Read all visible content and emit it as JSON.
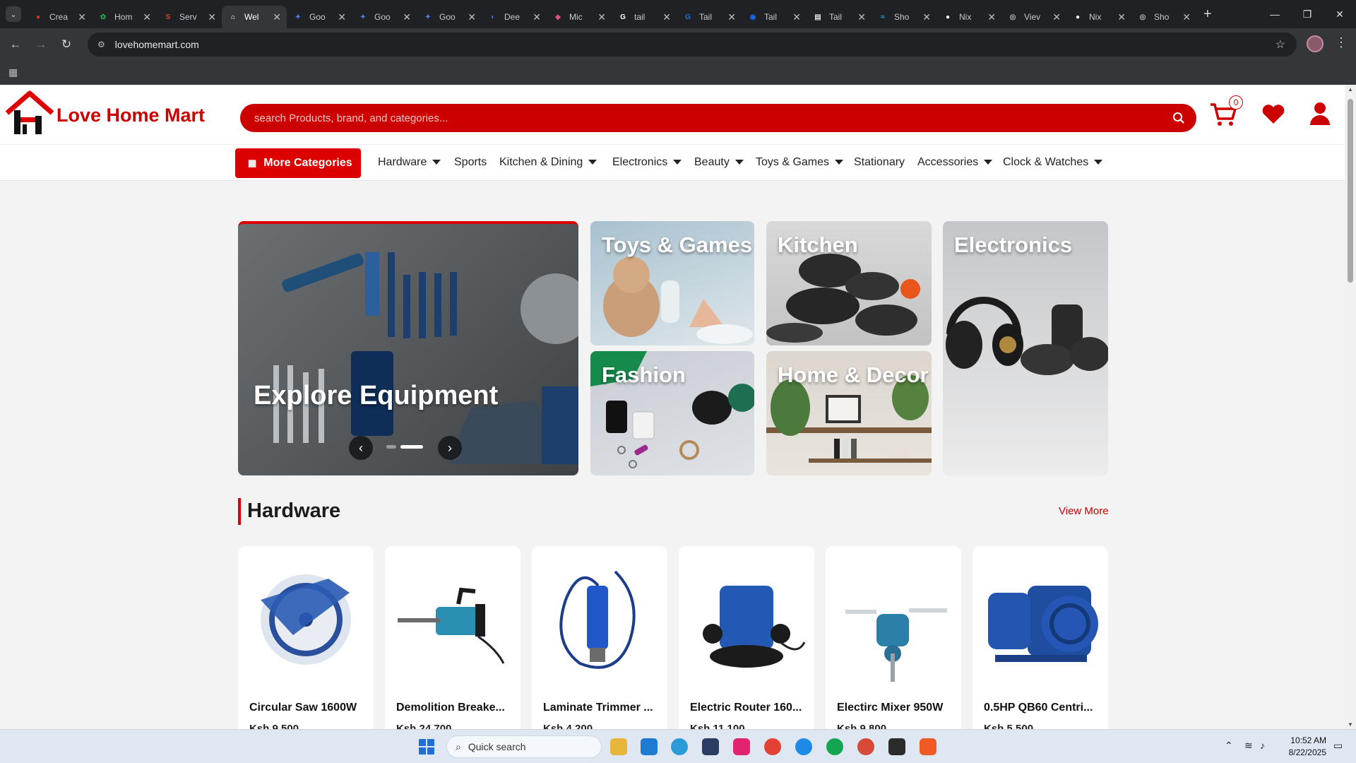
{
  "browser": {
    "tabs": [
      {
        "title": "Crea",
        "fav_color": "#d93025",
        "glyph": "●"
      },
      {
        "title": "Hom",
        "fav_color": "#23a84b",
        "glyph": "✿"
      },
      {
        "title": "Serv",
        "fav_color": "#d2481e",
        "glyph": "S"
      },
      {
        "title": "Wel",
        "fav_color": "#ffffff",
        "glyph": "⌂",
        "active": true
      },
      {
        "title": "Goo",
        "fav_color": "#4a7de8",
        "glyph": "✦"
      },
      {
        "title": "Goo",
        "fav_color": "#4a7de8",
        "glyph": "✦"
      },
      {
        "title": "Goo",
        "fav_color": "#4a7de8",
        "glyph": "✦"
      },
      {
        "title": "Dee",
        "fav_color": "#4d6bfe",
        "glyph": "◐"
      },
      {
        "title": "Mic",
        "fav_color": "#e24d8a",
        "glyph": "◆"
      },
      {
        "title": "tail",
        "fav_color": "#ffffff",
        "glyph": "G"
      },
      {
        "title": "Tail",
        "fav_color": "#1a73e8",
        "glyph": "G"
      },
      {
        "title": "Tail",
        "fav_color": "#1b66e6",
        "glyph": "◉"
      },
      {
        "title": "Tail",
        "fav_color": "#dcdcdc",
        "glyph": "▤"
      },
      {
        "title": "Sho",
        "fav_color": "#1aa7ec",
        "glyph": "≈"
      },
      {
        "title": "Nix",
        "fav_color": "#ffffff",
        "glyph": "●"
      },
      {
        "title": "Viev",
        "fav_color": "#bdbdbd",
        "glyph": "◎"
      },
      {
        "title": "Nix",
        "fav_color": "#ffffff",
        "glyph": "●"
      },
      {
        "title": "Sho",
        "fav_color": "#bdbdbd",
        "glyph": "◎"
      }
    ],
    "url": "lovehomemart.com"
  },
  "site": {
    "logo_text": "Love Home Mart",
    "search_placeholder": "search Products, brand, and categories...",
    "cart_count": "0",
    "brand_color": "#cc0000",
    "more_categories": "More Categories",
    "categories": [
      {
        "label": "Hardware",
        "dropdown": true
      },
      {
        "label": "Sports",
        "dropdown": false
      },
      {
        "label": "Kitchen & Dining",
        "dropdown": true
      },
      {
        "label": "Electronics",
        "dropdown": true
      },
      {
        "label": "Beauty",
        "dropdown": true
      },
      {
        "label": "Toys & Games",
        "dropdown": true
      },
      {
        "label": "Stationary",
        "dropdown": false
      },
      {
        "label": "Accessories",
        "dropdown": true
      },
      {
        "label": "Clock & Watches",
        "dropdown": true
      }
    ]
  },
  "hero": {
    "slide_title": "Explore Equipment",
    "prev_glyph": "‹",
    "next_glyph": "›",
    "tiles": {
      "toys": "Toys & Games",
      "kitchen": "Kitchen",
      "electronics": "Electronics",
      "fashion": "Fashion",
      "home": "Home & Decor"
    }
  },
  "section": {
    "title": "Hardware",
    "view_more": "View More",
    "products": [
      {
        "name": "Circular Saw 1600W",
        "price": "Ksh 9,500"
      },
      {
        "name": "Demolition Breake...",
        "price": "Ksh 24,700"
      },
      {
        "name": "Laminate Trimmer ...",
        "price": "Ksh 4,200"
      },
      {
        "name": "Electric Router 160...",
        "price": "Ksh 11,100"
      },
      {
        "name": "Electirc Mixer 950W",
        "price": "Ksh 9,800"
      },
      {
        "name": "0.5HP QB60 Centri...",
        "price": "Ksh 5,500"
      }
    ]
  },
  "taskbar": {
    "search_label": "Quick search",
    "time": "10:52 AM",
    "date": "8/22/2025"
  }
}
